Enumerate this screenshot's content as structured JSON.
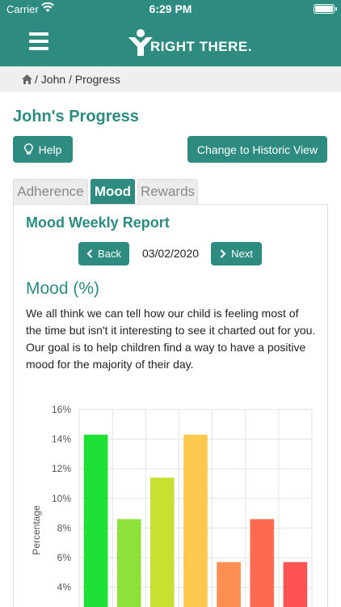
{
  "status_bar": {
    "carrier": "Carrier",
    "time": "6:29 PM"
  },
  "nav": {
    "logo_text": "RIGHT THERE."
  },
  "breadcrumb": {
    "text": "/ John / Progress"
  },
  "page": {
    "title": "John's Progress"
  },
  "buttons": {
    "help": "Help",
    "historic": "Change to Historic View",
    "back": "Back",
    "next": "Next"
  },
  "tabs": [
    {
      "label": "Adherence",
      "active": false
    },
    {
      "label": "Mood",
      "active": true
    },
    {
      "label": "Rewards",
      "active": false
    }
  ],
  "report": {
    "title": "Mood Weekly Report",
    "date": "03/02/2020",
    "section_title": "Mood (%)",
    "description": "We all think we can tell how our child is feeling most of the time but isn't it interesting to see it charted out for you. Our goal is to help children find a way to have a positive mood for the majority of their day."
  },
  "colors": {
    "brand": "#2e8b7f"
  },
  "chart_data": {
    "type": "bar",
    "ylabel": "Percentage",
    "xlabel": "",
    "ylim": [
      0,
      16
    ],
    "yticks": [
      "16%",
      "14%",
      "12%",
      "10%",
      "8%",
      "6%",
      "4%"
    ],
    "values": [
      14.3,
      8.6,
      11.4,
      14.3,
      5.7,
      8.6,
      5.7
    ],
    "colors": [
      "#1de235",
      "#8ee03a",
      "#c9e030",
      "#fdc94f",
      "#fd8f52",
      "#fd6a52",
      "#fd5254"
    ],
    "grid": true
  }
}
